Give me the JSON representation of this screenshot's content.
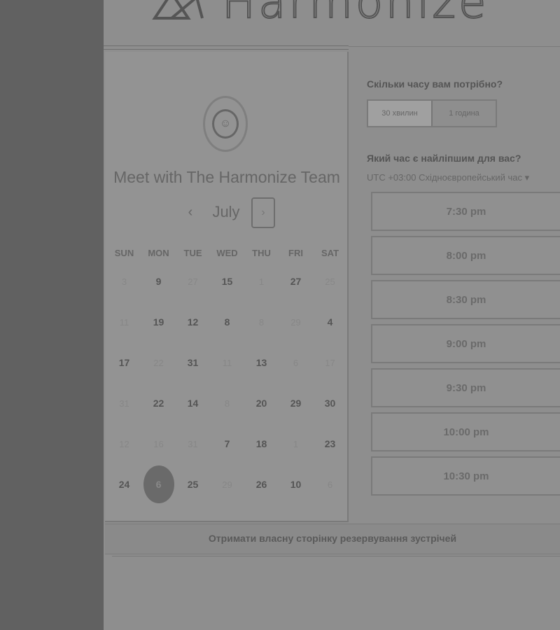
{
  "brand": {
    "name": "Harmonize"
  },
  "calendar": {
    "title": "Meet with The Harmonize Team",
    "month": "July",
    "prev_glyph": "‹",
    "next_glyph": "›",
    "weekdays": [
      "SUN",
      "MON",
      "TUE",
      "WED",
      "THU",
      "FRI",
      "SAT"
    ],
    "weeks": [
      [
        {
          "d": "3",
          "dim": true
        },
        {
          "d": "9",
          "dim": false
        },
        {
          "d": "27",
          "dim": true
        },
        {
          "d": "15",
          "dim": false
        },
        {
          "d": "1",
          "dim": true
        },
        {
          "d": "27",
          "dim": false
        },
        {
          "d": "25",
          "dim": true
        }
      ],
      [
        {
          "d": "11",
          "dim": true
        },
        {
          "d": "19",
          "dim": false
        },
        {
          "d": "12",
          "dim": false
        },
        {
          "d": "8",
          "dim": false
        },
        {
          "d": "8",
          "dim": true
        },
        {
          "d": "29",
          "dim": true
        },
        {
          "d": "4",
          "dim": false
        }
      ],
      [
        {
          "d": "17",
          "dim": false
        },
        {
          "d": "22",
          "dim": true
        },
        {
          "d": "31",
          "dim": false
        },
        {
          "d": "11",
          "dim": true
        },
        {
          "d": "13",
          "dim": false
        },
        {
          "d": "6",
          "dim": true
        },
        {
          "d": "17",
          "dim": true
        }
      ],
      [
        {
          "d": "31",
          "dim": true
        },
        {
          "d": "22",
          "dim": false
        },
        {
          "d": "14",
          "dim": false
        },
        {
          "d": "8",
          "dim": true
        },
        {
          "d": "20",
          "dim": false
        },
        {
          "d": "29",
          "dim": false
        },
        {
          "d": "30",
          "dim": false
        }
      ],
      [
        {
          "d": "12",
          "dim": true
        },
        {
          "d": "16",
          "dim": true
        },
        {
          "d": "31",
          "dim": true
        },
        {
          "d": "7",
          "dim": false
        },
        {
          "d": "18",
          "dim": false
        },
        {
          "d": "1",
          "dim": true
        },
        {
          "d": "23",
          "dim": false
        }
      ],
      [
        {
          "d": "24",
          "dim": false
        },
        {
          "d": "6",
          "dim": false,
          "selected": true
        },
        {
          "d": "25",
          "dim": false
        },
        {
          "d": "29",
          "dim": true
        },
        {
          "d": "26",
          "dim": false
        },
        {
          "d": "10",
          "dim": false
        },
        {
          "d": "6",
          "dim": true
        }
      ]
    ]
  },
  "booking": {
    "duration_question": "Скільки часу вам потрібно?",
    "durations": [
      "30 хвилин",
      "1 година"
    ],
    "time_question": "Який час є найліпшим для вас?",
    "timezone": "UTC +03:00 Східноєвропейський час ▾",
    "slots": [
      "7:30 pm",
      "8:00 pm",
      "8:30 pm",
      "9:00 pm",
      "9:30 pm",
      "10:00 pm",
      "10:30 pm"
    ]
  },
  "footer": {
    "link": "Отримати власну сторінку резервування зустрічей"
  }
}
